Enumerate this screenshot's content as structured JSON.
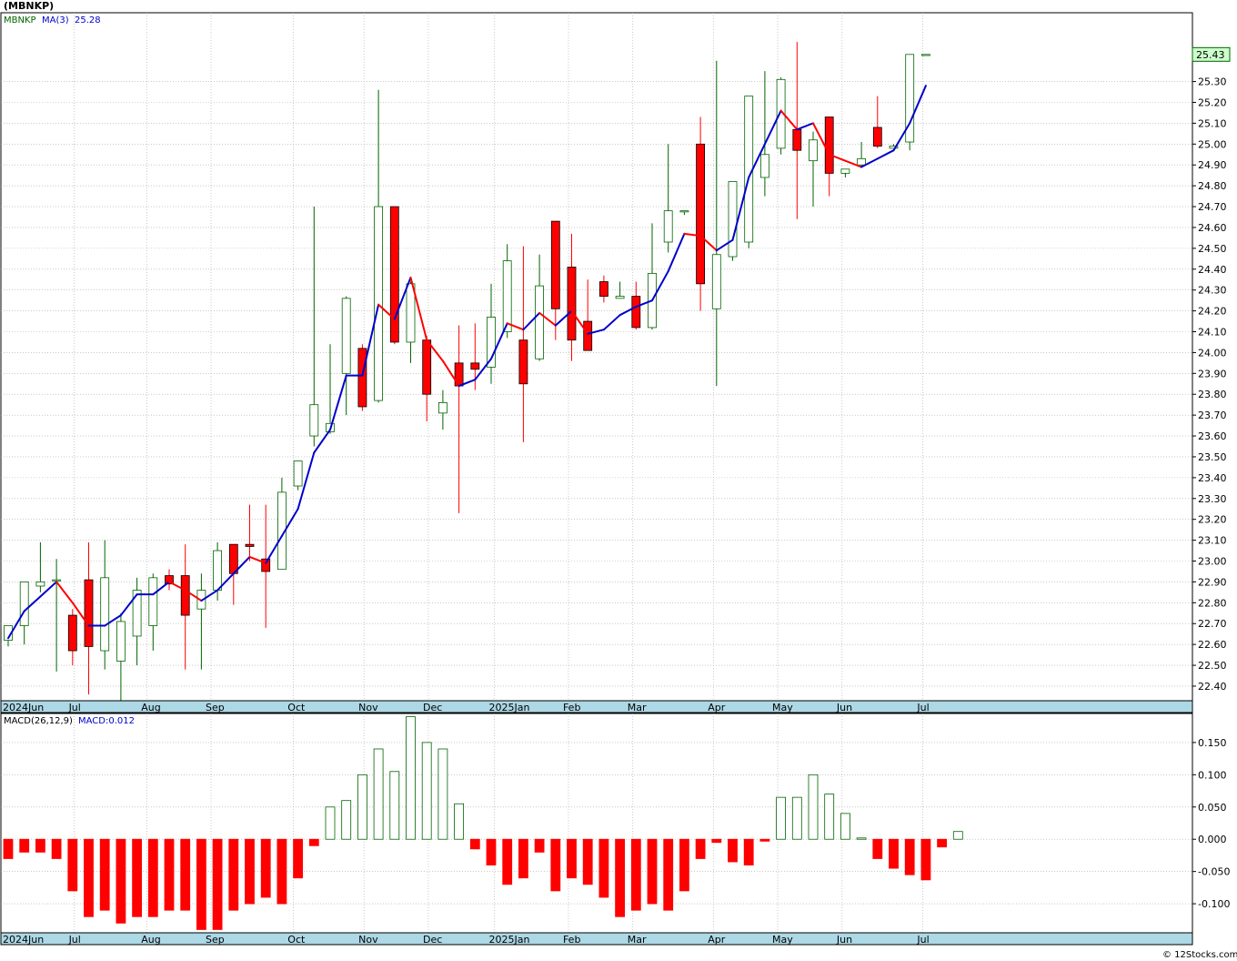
{
  "header": {
    "title": "(MBNKP)",
    "legend_symbol": "MBNKP",
    "legend_ma_label": "MA(3)",
    "legend_ma_value": "25.28",
    "macd_label": "MACD(26,12,9)",
    "macd_value": "MACD:0.012",
    "last_price_tag": "25.43",
    "copyright": "© 12Stocks.com"
  },
  "colors": {
    "up": "#006400",
    "down": "#ff0000",
    "ma_up": "#0000cc",
    "ma_down": "#ff0000",
    "axis_strip": "#add8e6",
    "grid": "#a9a9a9",
    "tag_bg": "#ccffcc"
  },
  "months": [
    {
      "label": "2024Jun",
      "week": 0
    },
    {
      "label": "Jul",
      "week": 4.1
    },
    {
      "label": "Aug",
      "week": 8.6
    },
    {
      "label": "Sep",
      "week": 12.6
    },
    {
      "label": "Oct",
      "week": 17.7
    },
    {
      "label": "Nov",
      "week": 22.1
    },
    {
      "label": "Dec",
      "week": 26.1
    },
    {
      "label": "2025Jan",
      "week": 30.2
    },
    {
      "label": "Feb",
      "week": 34.8
    },
    {
      "label": "Mar",
      "week": 38.8
    },
    {
      "label": "Apr",
      "week": 43.8
    },
    {
      "label": "May",
      "week": 47.8
    },
    {
      "label": "Jun",
      "week": 51.8
    },
    {
      "label": "Jul",
      "week": 56.8
    }
  ],
  "chart_data": [
    {
      "type": "candlestick",
      "title": "(MBNKP)",
      "interval": "weekly",
      "ylim": [
        22.33,
        25.63
      ],
      "y_ticks": [
        22.4,
        22.5,
        22.6,
        22.7,
        22.8,
        22.9,
        23.0,
        23.1,
        23.2,
        23.3,
        23.4,
        23.5,
        23.6,
        23.7,
        23.8,
        23.9,
        24.0,
        24.1,
        24.2,
        24.3,
        24.4,
        24.5,
        24.6,
        24.7,
        24.8,
        24.9,
        25.0,
        25.1,
        25.2,
        25.3
      ],
      "y_tick_labels": [
        "22.40",
        "22.50",
        "22.60",
        "22.70",
        "22.80",
        "22.90",
        "23.00",
        "23.10",
        "23.20",
        "23.30",
        "23.40",
        "23.50",
        "23.60",
        "23.70",
        "23.80",
        "23.90",
        "24.00",
        "24.10",
        "24.20",
        "24.30",
        "24.40",
        "24.50",
        "24.60",
        "24.70",
        "24.80",
        "24.90",
        "25.00",
        "25.10",
        "25.20",
        "25.30"
      ],
      "grid": true,
      "series_ma_name": "MA(3)",
      "candles": [
        {
          "o": 22.62,
          "h": 22.69,
          "l": 22.59,
          "c": 22.69
        },
        {
          "o": 22.69,
          "h": 22.9,
          "l": 22.6,
          "c": 22.9
        },
        {
          "o": 22.88,
          "h": 23.09,
          "l": 22.85,
          "c": 22.9
        },
        {
          "o": 22.91,
          "h": 23.01,
          "l": 22.47,
          "c": 22.91
        },
        {
          "o": 22.74,
          "h": 22.77,
          "l": 22.5,
          "c": 22.57
        },
        {
          "o": 22.91,
          "h": 23.09,
          "l": 22.36,
          "c": 22.59
        },
        {
          "o": 22.57,
          "h": 23.1,
          "l": 22.48,
          "c": 22.92
        },
        {
          "o": 22.52,
          "h": 22.75,
          "l": 22.33,
          "c": 22.71
        },
        {
          "o": 22.64,
          "h": 22.92,
          "l": 22.5,
          "c": 22.86
        },
        {
          "o": 22.69,
          "h": 22.94,
          "l": 22.57,
          "c": 22.92
        },
        {
          "o": 22.93,
          "h": 22.96,
          "l": 22.86,
          "c": 22.89
        },
        {
          "o": 22.93,
          "h": 23.08,
          "l": 22.48,
          "c": 22.74
        },
        {
          "o": 22.77,
          "h": 22.94,
          "l": 22.48,
          "c": 22.86
        },
        {
          "o": 22.86,
          "h": 23.09,
          "l": 22.81,
          "c": 23.05
        },
        {
          "o": 23.08,
          "h": 23.08,
          "l": 22.79,
          "c": 22.94
        },
        {
          "o": 23.08,
          "h": 23.27,
          "l": 23.0,
          "c": 23.07
        },
        {
          "o": 23.01,
          "h": 23.27,
          "l": 22.68,
          "c": 22.95
        },
        {
          "o": 22.96,
          "h": 23.4,
          "l": 22.96,
          "c": 23.33
        },
        {
          "o": 23.36,
          "h": 23.48,
          "l": 23.34,
          "c": 23.48
        },
        {
          "o": 23.6,
          "h": 24.7,
          "l": 23.55,
          "c": 23.75
        },
        {
          "o": 23.62,
          "h": 24.04,
          "l": 23.61,
          "c": 23.66
        },
        {
          "o": 23.9,
          "h": 24.27,
          "l": 23.7,
          "c": 24.26
        },
        {
          "o": 24.02,
          "h": 24.04,
          "l": 23.72,
          "c": 23.74
        },
        {
          "o": 23.77,
          "h": 25.26,
          "l": 23.76,
          "c": 24.7
        },
        {
          "o": 24.7,
          "h": 24.7,
          "l": 24.04,
          "c": 24.05
        },
        {
          "o": 24.05,
          "h": 24.34,
          "l": 23.95,
          "c": 24.33
        },
        {
          "o": 24.06,
          "h": 24.08,
          "l": 23.67,
          "c": 23.8
        },
        {
          "o": 23.71,
          "h": 23.82,
          "l": 23.63,
          "c": 23.76
        },
        {
          "o": 23.95,
          "h": 24.13,
          "l": 23.23,
          "c": 23.84
        },
        {
          "o": 23.95,
          "h": 24.14,
          "l": 23.82,
          "c": 23.92
        },
        {
          "o": 23.93,
          "h": 24.33,
          "l": 23.85,
          "c": 24.17
        },
        {
          "o": 24.1,
          "h": 24.52,
          "l": 24.07,
          "c": 24.44
        },
        {
          "o": 24.06,
          "h": 24.51,
          "l": 23.57,
          "c": 23.85
        },
        {
          "o": 23.97,
          "h": 24.47,
          "l": 23.96,
          "c": 24.32
        },
        {
          "o": 24.63,
          "h": 24.63,
          "l": 24.06,
          "c": 24.21
        },
        {
          "o": 24.41,
          "h": 24.57,
          "l": 23.96,
          "c": 24.06
        },
        {
          "o": 24.15,
          "h": 24.35,
          "l": 24.01,
          "c": 24.01
        },
        {
          "o": 24.34,
          "h": 24.37,
          "l": 24.24,
          "c": 24.27
        },
        {
          "o": 24.26,
          "h": 24.34,
          "l": 24.26,
          "c": 24.27
        },
        {
          "o": 24.27,
          "h": 24.34,
          "l": 24.11,
          "c": 24.12
        },
        {
          "o": 24.12,
          "h": 24.62,
          "l": 24.11,
          "c": 24.38
        },
        {
          "o": 24.53,
          "h": 25.0,
          "l": 24.48,
          "c": 24.68
        },
        {
          "o": 24.68,
          "h": 24.68,
          "l": 24.66,
          "c": 24.68
        },
        {
          "o": 25.0,
          "h": 25.13,
          "l": 24.2,
          "c": 24.33
        },
        {
          "o": 24.21,
          "h": 25.4,
          "l": 23.84,
          "c": 24.47
        },
        {
          "o": 24.46,
          "h": 24.82,
          "l": 24.44,
          "c": 24.82
        },
        {
          "o": 24.53,
          "h": 25.23,
          "l": 24.5,
          "c": 25.23
        },
        {
          "o": 24.84,
          "h": 25.35,
          "l": 24.75,
          "c": 24.95
        },
        {
          "o": 24.98,
          "h": 25.32,
          "l": 24.95,
          "c": 25.31
        },
        {
          "o": 25.07,
          "h": 25.49,
          "l": 24.64,
          "c": 24.97
        },
        {
          "o": 24.92,
          "h": 25.06,
          "l": 24.7,
          "c": 25.02
        },
        {
          "o": 25.13,
          "h": 25.13,
          "l": 24.75,
          "c": 24.86
        },
        {
          "o": 24.86,
          "h": 24.88,
          "l": 24.84,
          "c": 24.88
        },
        {
          "o": 24.9,
          "h": 25.01,
          "l": 24.89,
          "c": 24.93
        },
        {
          "o": 25.08,
          "h": 25.23,
          "l": 24.98,
          "c": 24.99
        },
        {
          "o": 24.98,
          "h": 25.0,
          "l": 24.98,
          "c": 24.99
        },
        {
          "o": 25.01,
          "h": 25.43,
          "l": 24.97,
          "c": 25.43
        },
        {
          "o": 25.43,
          "h": 25.43,
          "l": 25.43,
          "c": 25.43
        }
      ],
      "ma3": [
        22.63,
        22.76,
        22.83,
        22.9,
        22.8,
        22.69,
        22.69,
        22.74,
        22.84,
        22.84,
        22.9,
        22.86,
        22.81,
        22.86,
        22.94,
        23.02,
        22.99,
        23.12,
        23.25,
        23.52,
        23.63,
        23.89,
        23.89,
        24.23,
        24.16,
        24.36,
        24.06,
        23.96,
        23.84,
        23.87,
        23.97,
        24.14,
        24.11,
        24.19,
        24.13,
        24.2,
        24.09,
        24.11,
        24.18,
        24.22,
        24.25,
        24.39,
        24.57,
        24.56,
        24.49,
        24.54,
        24.84,
        25.0,
        25.16,
        25.07,
        25.1,
        24.95,
        24.92,
        24.89,
        24.93,
        24.97,
        25.1,
        25.28
      ]
    },
    {
      "type": "bar",
      "title": "MACD(26,12,9)",
      "series_name": "MACD",
      "last_value": 0.012,
      "ylim": [
        -0.145,
        0.195
      ],
      "y_ticks": [
        0.15,
        0.1,
        0.05,
        0.0,
        -0.05,
        -0.1
      ],
      "y_tick_labels": [
        "0.150",
        "0.100",
        "0.050",
        "0.000",
        "-0.050",
        "-0.100"
      ],
      "grid": true,
      "values": [
        -0.03,
        -0.02,
        -0.02,
        -0.03,
        -0.08,
        -0.12,
        -0.11,
        -0.13,
        -0.12,
        -0.12,
        -0.11,
        -0.11,
        -0.14,
        -0.14,
        -0.11,
        -0.1,
        -0.09,
        -0.1,
        -0.06,
        -0.01,
        0.05,
        0.06,
        0.1,
        0.14,
        0.105,
        0.19,
        0.15,
        0.14,
        0.055,
        -0.015,
        -0.04,
        -0.07,
        -0.06,
        -0.02,
        -0.08,
        -0.06,
        -0.07,
        -0.09,
        -0.12,
        -0.11,
        -0.1,
        -0.11,
        -0.08,
        -0.03,
        -0.005,
        -0.035,
        -0.04,
        -0.003,
        0.065,
        0.065,
        0.1,
        0.07,
        0.04,
        0.002,
        -0.03,
        -0.045,
        -0.055,
        -0.063,
        -0.012,
        0.012
      ]
    }
  ]
}
